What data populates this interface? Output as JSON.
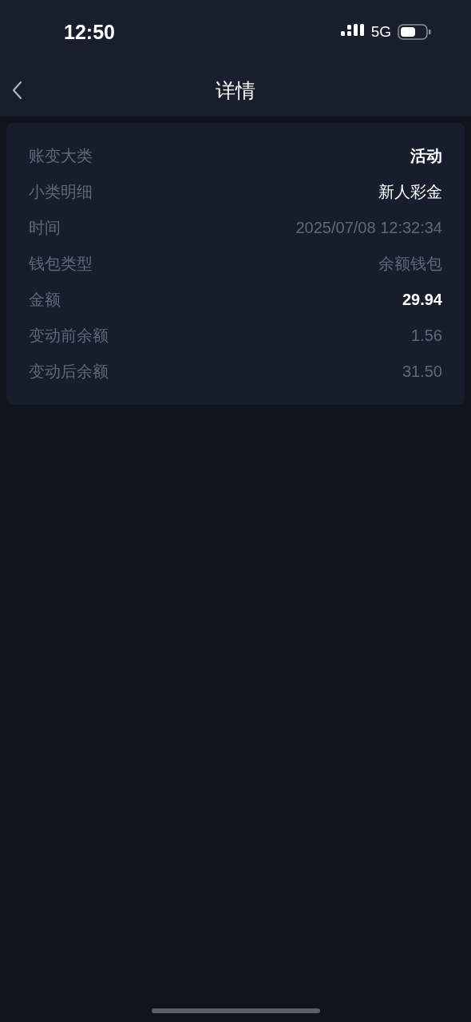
{
  "status_bar": {
    "time": "12:50",
    "network": "5G"
  },
  "nav": {
    "title": "详情"
  },
  "details": [
    {
      "label": "账变大类",
      "value": "活动",
      "kind": "strong"
    },
    {
      "label": "小类明细",
      "value": "新人彩金",
      "kind": "normal"
    },
    {
      "label": "时间",
      "value": "2025/07/08 12:32:34",
      "kind": "muted"
    },
    {
      "label": "钱包类型",
      "value": "余额钱包",
      "kind": "muted"
    },
    {
      "label": "金额",
      "value": "29.94",
      "kind": "strong"
    },
    {
      "label": "变动前余额",
      "value": "1.56",
      "kind": "muted"
    },
    {
      "label": "变动后余额",
      "value": "31.50",
      "kind": "muted"
    }
  ]
}
